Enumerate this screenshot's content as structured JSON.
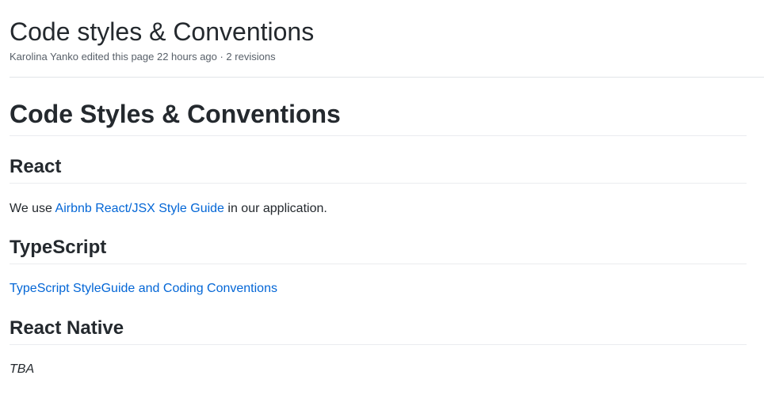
{
  "header": {
    "title": "Code styles & Conventions",
    "meta": "Karolina Yanko edited this page 22 hours ago · 2 revisions"
  },
  "content": {
    "main_heading": "Code Styles & Conventions",
    "sections": [
      {
        "heading": "React",
        "text_before": "We use ",
        "link_label": "Airbnb React/JSX Style Guide",
        "text_after": " in our application."
      },
      {
        "heading": "TypeScript",
        "link_label": "TypeScript StyleGuide and Coding Conventions"
      },
      {
        "heading": "React Native",
        "text": "TBA"
      }
    ]
  },
  "colors": {
    "text": "#24292e",
    "muted": "#586069",
    "link": "#0366d6",
    "divider": "#eaecef"
  }
}
